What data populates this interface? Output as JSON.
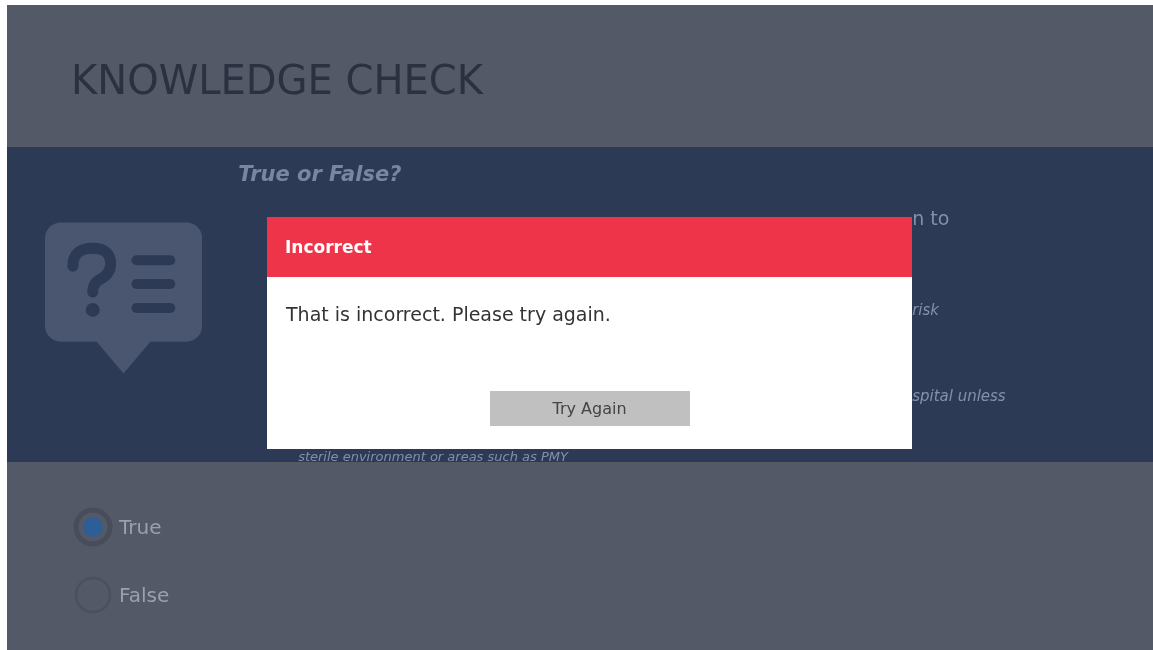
{
  "title": "KNOWLEDGE CHECK",
  "question": {
    "heading": "True or False?",
    "fragments": [
      {
        "kind": "line",
        "text": "n to"
      },
      {
        "kind": "italic",
        "text": "risk"
      },
      {
        "kind": "italic",
        "text": "spital unless"
      },
      {
        "kind": "italic",
        "text": "sterile environment or areas such as PMY"
      }
    ]
  },
  "options": [
    {
      "label": "True",
      "selected": true
    },
    {
      "label": "False",
      "selected": false
    }
  ],
  "dialog": {
    "title": "Incorrect",
    "message": "That is incorrect. Please try again.",
    "button": "Try Again"
  }
}
